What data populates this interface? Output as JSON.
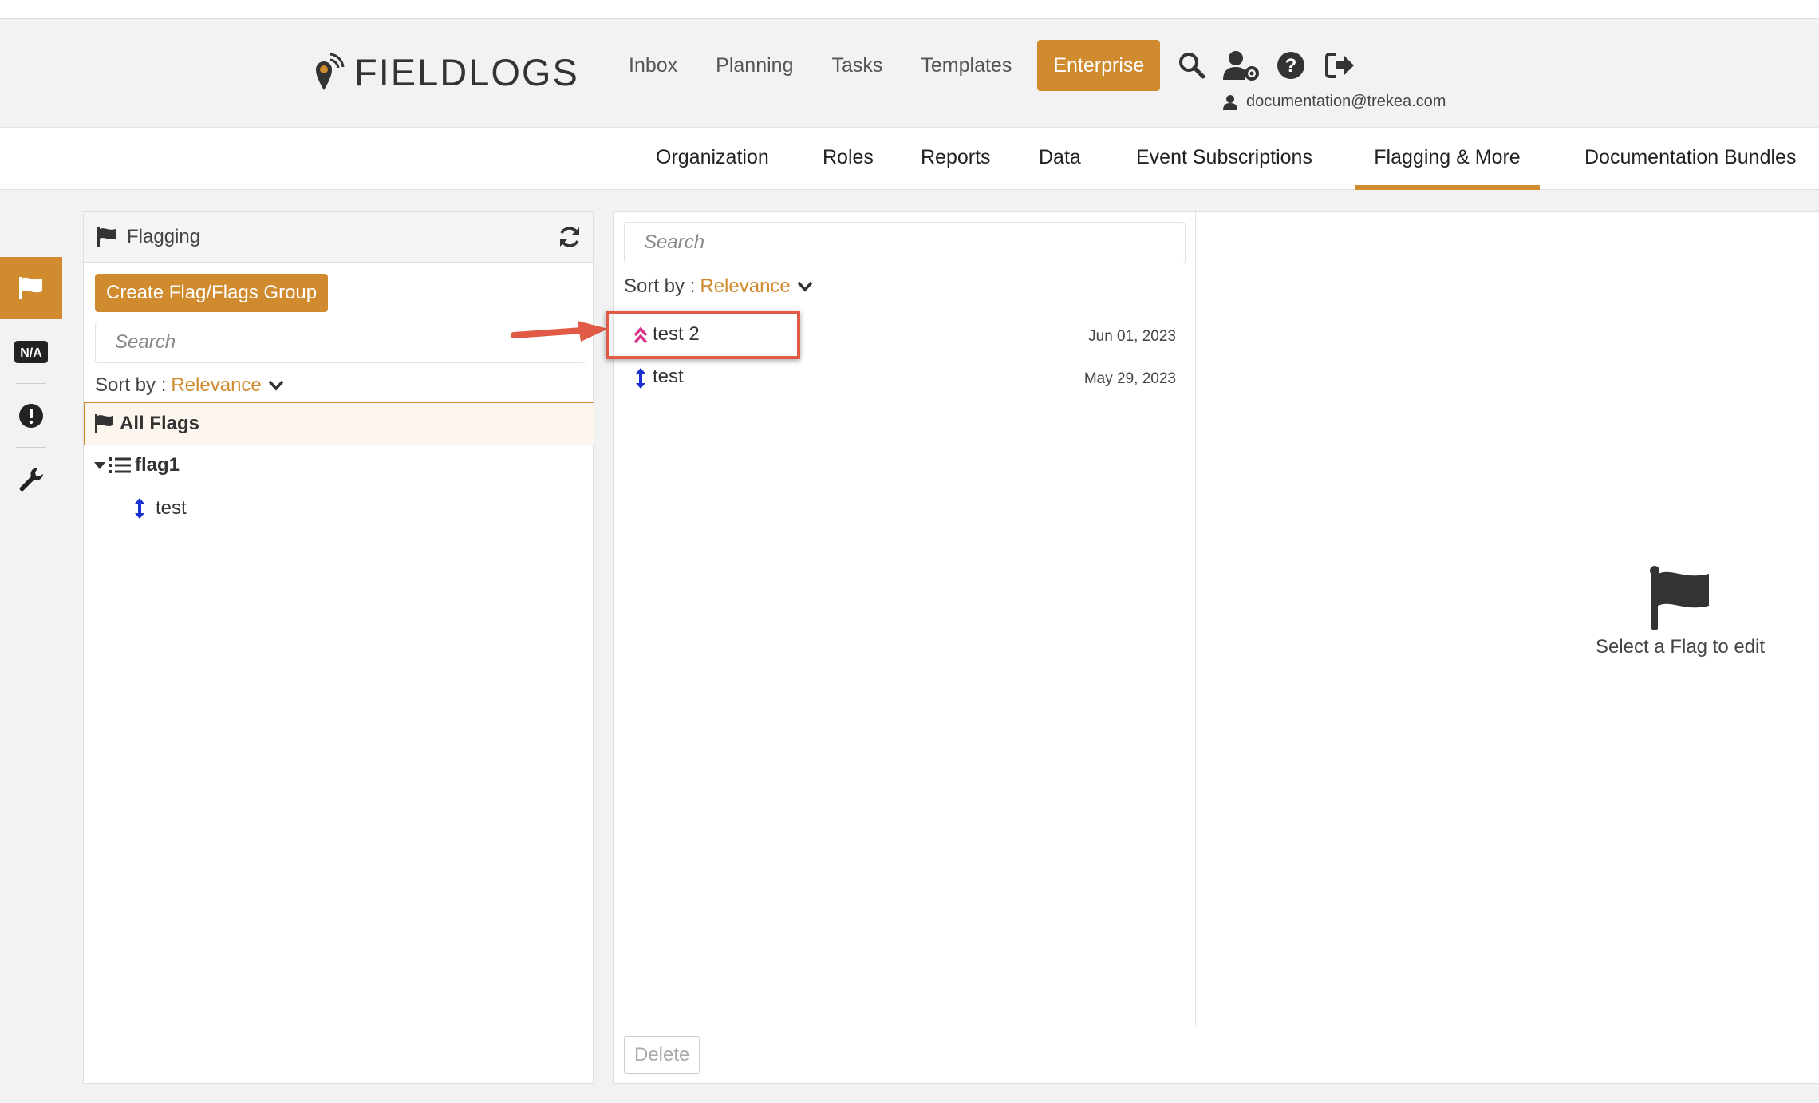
{
  "header": {
    "logo_text": "FIELDLOGS",
    "nav": [
      {
        "label": "Inbox"
      },
      {
        "label": "Planning"
      },
      {
        "label": "Tasks"
      },
      {
        "label": "Templates"
      },
      {
        "label": "Enterprise"
      }
    ],
    "user_email": "documentation@trekea.com"
  },
  "sub_nav": {
    "items": [
      {
        "label": "Organization"
      },
      {
        "label": "Roles"
      },
      {
        "label": "Reports"
      },
      {
        "label": "Data"
      },
      {
        "label": "Event Subscriptions"
      },
      {
        "label": "Flagging & More"
      },
      {
        "label": "Documentation Bundles"
      }
    ],
    "active": "Flagging & More"
  },
  "rail": {
    "items": [
      {
        "icon": "flag-icon",
        "active": true
      },
      {
        "icon": "na-icon",
        "label": "N/A"
      },
      {
        "icon": "exclamation-icon"
      },
      {
        "icon": "wrench-icon"
      }
    ]
  },
  "left_panel": {
    "title": "Flagging",
    "create_label": "Create Flag/Flags Group",
    "search_placeholder": "Search",
    "sort_label": "Sort by :",
    "sort_value": "Relevance",
    "all_flags_label": "All Flags",
    "tree": {
      "group_label": "flag1",
      "children": [
        {
          "label": "test"
        }
      ]
    }
  },
  "mid_panel": {
    "search_placeholder": "Search",
    "sort_label": "Sort by :",
    "sort_value": "Relevance",
    "flags": [
      {
        "name": "test 2",
        "date": "Jun 01, 2023",
        "icon": "double-chevron-up-icon"
      },
      {
        "name": "test",
        "date": "May 29, 2023",
        "icon": "vertical-arrows-icon"
      }
    ],
    "delete_label": "Delete"
  },
  "editor": {
    "empty_text": "Select a Flag to edit"
  },
  "colors": {
    "accent": "#d08b2f",
    "highlight": "#e05a45",
    "priority_high": "#d6358e",
    "priority_neutral": "#1a2fd1"
  }
}
